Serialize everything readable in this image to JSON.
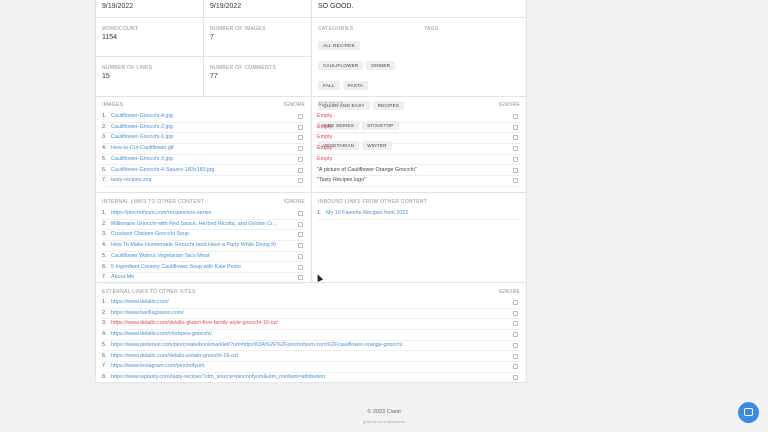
{
  "top": {
    "date1": "9/19/2022",
    "date2": "9/19/2022",
    "note": "SO GOOD."
  },
  "stats": {
    "wordcount_label": "WORDCOUNT",
    "wordcount_value": "1154",
    "images_label": "NUMBER OF IMAGES",
    "images_value": "7",
    "links_label": "NUMBER OF LINKS",
    "links_value": "15",
    "comments_label": "NUMBER OF COMMENTS",
    "comments_value": "77"
  },
  "taxonomy": {
    "categories_label": "CATEGORIES",
    "tags_label": "TAGS",
    "categories": [
      "ALL RECIPES",
      "CAULIFLOWER",
      "DINNER",
      "FALL",
      "PASTA",
      "QUICK AND EASY",
      "RECIPES",
      "SIDE SERIES",
      "STOVETOP",
      "VEGETARIAN",
      "WINTER"
    ]
  },
  "images": {
    "label": "IMAGES",
    "ignore": "IGNORE",
    "items": [
      "Cauliflower-Gnocchi-4.jpg",
      "Cauliflower-Gnocchi-2.jpg",
      "Cauliflower-Gnocchi-1.jpg",
      "How-to-Cut-Cauliflower.gif",
      "Cauliflower-Gnocchi-3.jpg",
      "Cauliflower-Gnocchi-4-Square-183x183.jpg",
      "tasty-recipes.svg"
    ]
  },
  "alt_text": {
    "label": "ALT TEXT",
    "ignore": "IGNORE",
    "items": [
      "Empty",
      "Empty",
      "Empty",
      "Empty",
      "Empty",
      "\"A picture of Cauliflower Orange Gnocchi\"",
      "\"Tasty Recipes logo\""
    ]
  },
  "internal_links": {
    "label": "INTERNAL LINKS TO OTHER CONTENT",
    "ignore": "IGNORE",
    "items": [
      "https://pinchofyum.com/recipes/sos-series",
      "Millionaire Gnocchi with Red Sauce, Herbed Ricotta, and Golden Cr...",
      "Crockpot Chicken Gnocchi Soup",
      "How To Make Homemade Gnocchi (and Have a Party While Doing It)",
      "Cauliflower Walnut Vegetarian Taco Meat",
      "5 Ingredient Creamy Cauliflower Soup with Kale Pesto",
      "About Me"
    ]
  },
  "inbound_links": {
    "label": "INBOUND LINKS FROM OTHER CONTENT",
    "items": [
      "My 10 Favorite Recipes from 2022"
    ]
  },
  "external_links": {
    "label": "EXTERNAL LINKS TO OTHER SITES",
    "ignore": "IGNORE",
    "items": [
      "https://www.delallo.com/",
      "https://www.barillagrasso.com/",
      "https://www.delallo.com/delallo-gluten-free-family-style-gnocchi-16-oz/",
      "https://www.delallo.com/chickpea-gnocchi/",
      "https://www.pinterest.com/pin/create/bookmarklet/?url=https%3A%2F%2Fpinchofyum.com%2Fcauliflower-orange-gnocchi",
      "https://www.delallo.com/delallo-potato-gnocchi-16-oz/",
      "https://www.instagram.com/pinchofyum",
      "https://www.wptasty.com/tasty-recipes?utm_source=pinchofyum&utm_medium=attribution"
    ]
  },
  "footer": {
    "copyright": "© 2023 Cianti",
    "sub": "grow on your standards"
  }
}
